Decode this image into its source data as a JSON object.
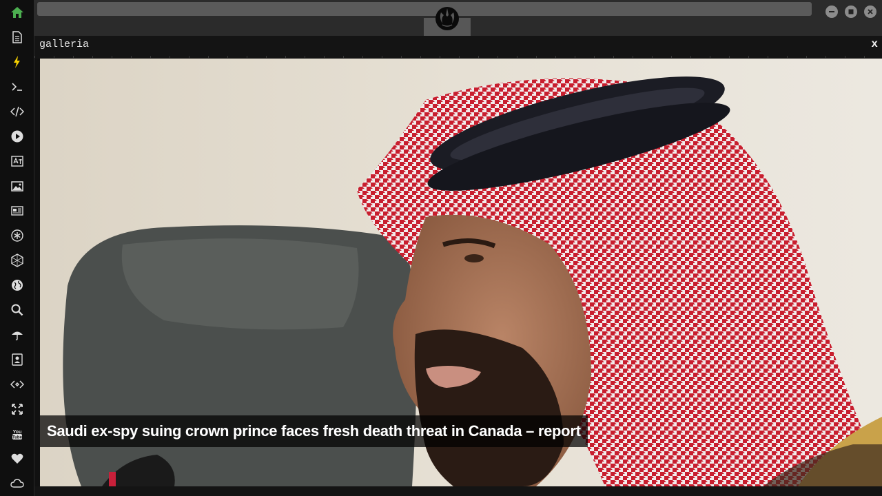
{
  "window": {
    "title": "galleria",
    "close_label": "x"
  },
  "gallery": {
    "caption": "Saudi ex-spy suing crown prince faces fresh death threat in Canada – report"
  },
  "sidebar": {
    "icons": [
      "home-icon",
      "document-icon",
      "lightning-icon",
      "terminal-icon",
      "code-icon",
      "play-icon",
      "translate-icon",
      "image-icon",
      "newspaper-icon",
      "asterisk-icon",
      "hexagon-icon",
      "globe-icon",
      "search-icon",
      "umbrella-icon",
      "contacts-icon",
      "exchange-icon",
      "expand-icon",
      "youtube-icon",
      "heart-icon",
      "cloud-icon"
    ],
    "active_color": "#4caf50",
    "accent_color": "#f5d000"
  },
  "titlebar": {
    "controls": [
      "minimize-icon",
      "maximize-icon",
      "close-icon"
    ]
  }
}
